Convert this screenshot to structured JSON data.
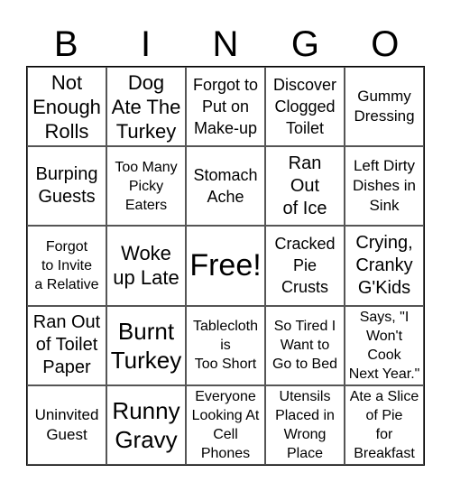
{
  "header": {
    "letters": [
      "B",
      "I",
      "N",
      "G",
      "O"
    ]
  },
  "board": {
    "rows": [
      [
        "Not\nEnough\nRolls",
        "Dog\nAte The\nTurkey",
        "Forgot to\nPut on\nMake-up",
        "Discover\nClogged\nToilet",
        "Gummy\nDressing"
      ],
      [
        "Burping\nGuests",
        "Too Many\nPicky\nEaters",
        "Stomach\nAche",
        "Ran\nOut\nof Ice",
        "Left Dirty\nDishes in\nSink"
      ],
      [
        "Forgot\nto Invite\na Relative",
        "Woke\nup Late",
        "Free!",
        "Cracked\nPie\nCrusts",
        "Crying,\nCranky\nG'Kids"
      ],
      [
        "Ran Out\nof Toilet\nPaper",
        "Burnt\nTurkey",
        "Tablecloth\nis\nToo Short",
        "So Tired I\nWant to\nGo to Bed",
        "Says, \"I\nWon't\nCook\nNext Year.\""
      ],
      [
        "Uninvited\nGuest",
        "Runny\nGravy",
        "Everyone\nLooking At\nCell\nPhones",
        "Utensils\nPlaced in\nWrong\nPlace",
        "Ate a Slice\nof Pie\nfor\nBreakfast"
      ]
    ]
  }
}
